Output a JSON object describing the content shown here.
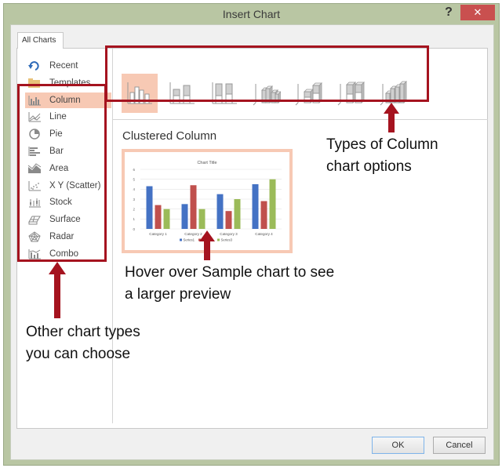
{
  "window": {
    "title": "Insert Chart",
    "help_label": "?",
    "close_label": "✕"
  },
  "tabs": [
    {
      "label": "All Charts",
      "active": true
    }
  ],
  "sidebar": {
    "items": [
      {
        "label": "Recent",
        "icon": "recent-icon",
        "selected": false
      },
      {
        "label": "Templates",
        "icon": "folder-icon",
        "selected": false
      },
      {
        "label": "Column",
        "icon": "column-chart-icon",
        "selected": true
      },
      {
        "label": "Line",
        "icon": "line-chart-icon",
        "selected": false
      },
      {
        "label": "Pie",
        "icon": "pie-chart-icon",
        "selected": false
      },
      {
        "label": "Bar",
        "icon": "bar-chart-icon",
        "selected": false
      },
      {
        "label": "Area",
        "icon": "area-chart-icon",
        "selected": false
      },
      {
        "label": "X Y (Scatter)",
        "icon": "scatter-chart-icon",
        "selected": false
      },
      {
        "label": "Stock",
        "icon": "stock-chart-icon",
        "selected": false
      },
      {
        "label": "Surface",
        "icon": "surface-chart-icon",
        "selected": false
      },
      {
        "label": "Radar",
        "icon": "radar-chart-icon",
        "selected": false
      },
      {
        "label": "Combo",
        "icon": "combo-chart-icon",
        "selected": false
      }
    ]
  },
  "subtypes": [
    {
      "name": "Clustered Column",
      "icon": "clustered-column-icon",
      "selected": true
    },
    {
      "name": "Stacked Column",
      "icon": "stacked-column-icon",
      "selected": false
    },
    {
      "name": "100% Stacked Column",
      "icon": "percent-stacked-column-icon",
      "selected": false
    },
    {
      "name": "3-D Clustered Column",
      "icon": "3d-clustered-column-icon",
      "selected": false
    },
    {
      "name": "3-D Stacked Column",
      "icon": "3d-stacked-column-icon",
      "selected": false
    },
    {
      "name": "3-D 100% Stacked Column",
      "icon": "3d-percent-stacked-column-icon",
      "selected": false
    },
    {
      "name": "3-D Column",
      "icon": "3d-column-icon",
      "selected": false
    }
  ],
  "selected_subtype_title": "Clustered Column",
  "buttons": {
    "ok": "OK",
    "cancel": "Cancel"
  },
  "annotations": {
    "top": [
      "Types of Column",
      "chart options"
    ],
    "middle": [
      "Hover over Sample chart to see",
      "a larger preview"
    ],
    "left": [
      "Other chart types",
      "you can choose"
    ],
    "color": "#a5131f"
  },
  "chart_data": {
    "type": "bar",
    "title": "Chart Title",
    "categories": [
      "Category 1",
      "Category 2",
      "Category 3",
      "Category 4"
    ],
    "series": [
      {
        "name": "Series1",
        "color": "#4472c4",
        "values": [
          4.3,
          2.5,
          3.5,
          4.5
        ]
      },
      {
        "name": "Series2",
        "color": "#c0504d",
        "values": [
          2.4,
          4.4,
          1.8,
          2.8
        ]
      },
      {
        "name": "Series3",
        "color": "#9bbb59",
        "values": [
          2,
          2,
          3,
          5
        ]
      }
    ],
    "xlabel": "",
    "ylabel": "",
    "ylim": [
      0,
      6
    ],
    "yticks": [
      0,
      1,
      2,
      3,
      4,
      5,
      6
    ],
    "grid": true,
    "legend": "bottom"
  }
}
